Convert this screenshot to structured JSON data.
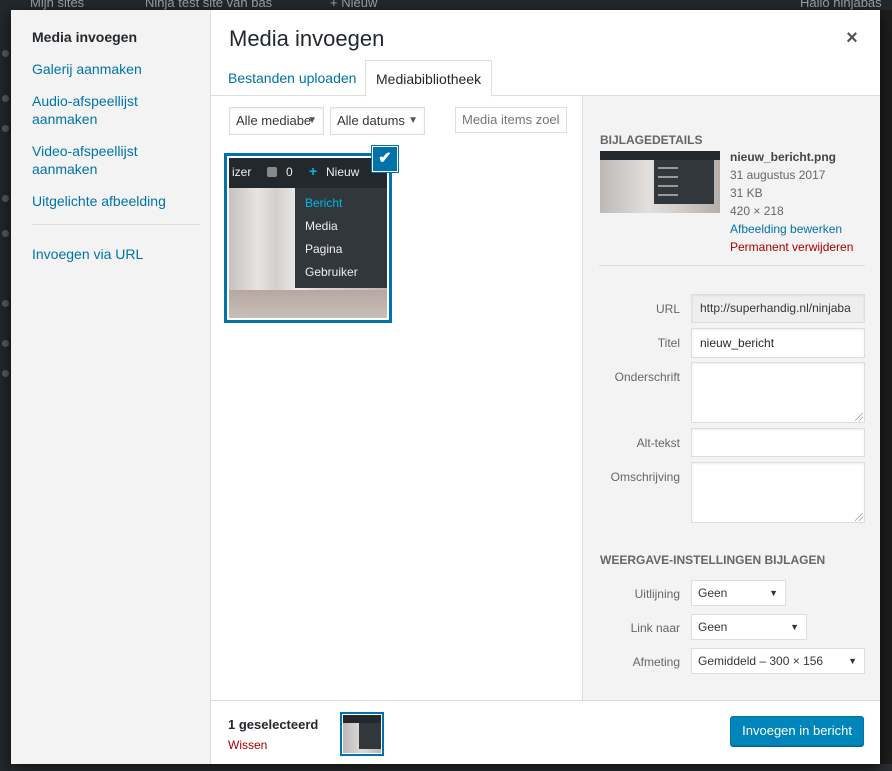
{
  "background": {
    "adminbar_items": [
      "Mijn sites",
      "Ninja test site van bas",
      "+ Nieuw",
      "Hallo ninjabas"
    ]
  },
  "menu": {
    "items": [
      {
        "label": "Media invoegen",
        "active": true
      },
      {
        "label": "Galerij aanmaken"
      },
      {
        "label": "Audio-afspeellijst aanmaken"
      },
      {
        "label": "Video-afspeellijst aanmaken"
      },
      {
        "label": "Uitgelichte afbeelding"
      }
    ],
    "url_item": "Invoegen via URL"
  },
  "title": "Media invoegen",
  "close_icon": "×",
  "tabs": {
    "upload": "Bestanden uploaden",
    "library": "Mediabibliotheek"
  },
  "filters": {
    "type": "Alle mediabe",
    "date": "Alle datums",
    "search_placeholder": "Media items zoel"
  },
  "attachment_preview": {
    "bar_left": "izer",
    "bar_count": "0",
    "new_label": "Nieuw",
    "menu": [
      "Bericht",
      "Media",
      "Pagina",
      "Gebruiker"
    ],
    "check": "✔"
  },
  "details": {
    "heading": "Bijlagedetails",
    "filename": "nieuw_bericht.png",
    "date": "31 augustus 2017",
    "size": "31 KB",
    "dimensions": "420 × 218",
    "edit_link": "Afbeelding bewerken",
    "delete_link": "Permanent verwijderen"
  },
  "fields": {
    "url_label": "URL",
    "url_value": "http://superhandig.nl/ninjaba",
    "title_label": "Titel",
    "title_value": "nieuw_bericht",
    "caption_label": "Onderschrift",
    "alt_label": "Alt-tekst",
    "description_label": "Omschrijving"
  },
  "display": {
    "heading": "Weergave-instellingen bijlagen",
    "align_label": "Uitlijning",
    "align_value": "Geen",
    "link_label": "Link naar",
    "link_value": "Geen",
    "size_label": "Afmeting",
    "size_value": "Gemiddeld – 300 × 156"
  },
  "footer": {
    "selected_count": "1 geselecteerd",
    "clear": "Wissen",
    "insert_button": "Invoegen in bericht"
  },
  "colors": {
    "accent": "#0073aa",
    "danger": "#a00",
    "button": "#0085ba"
  }
}
